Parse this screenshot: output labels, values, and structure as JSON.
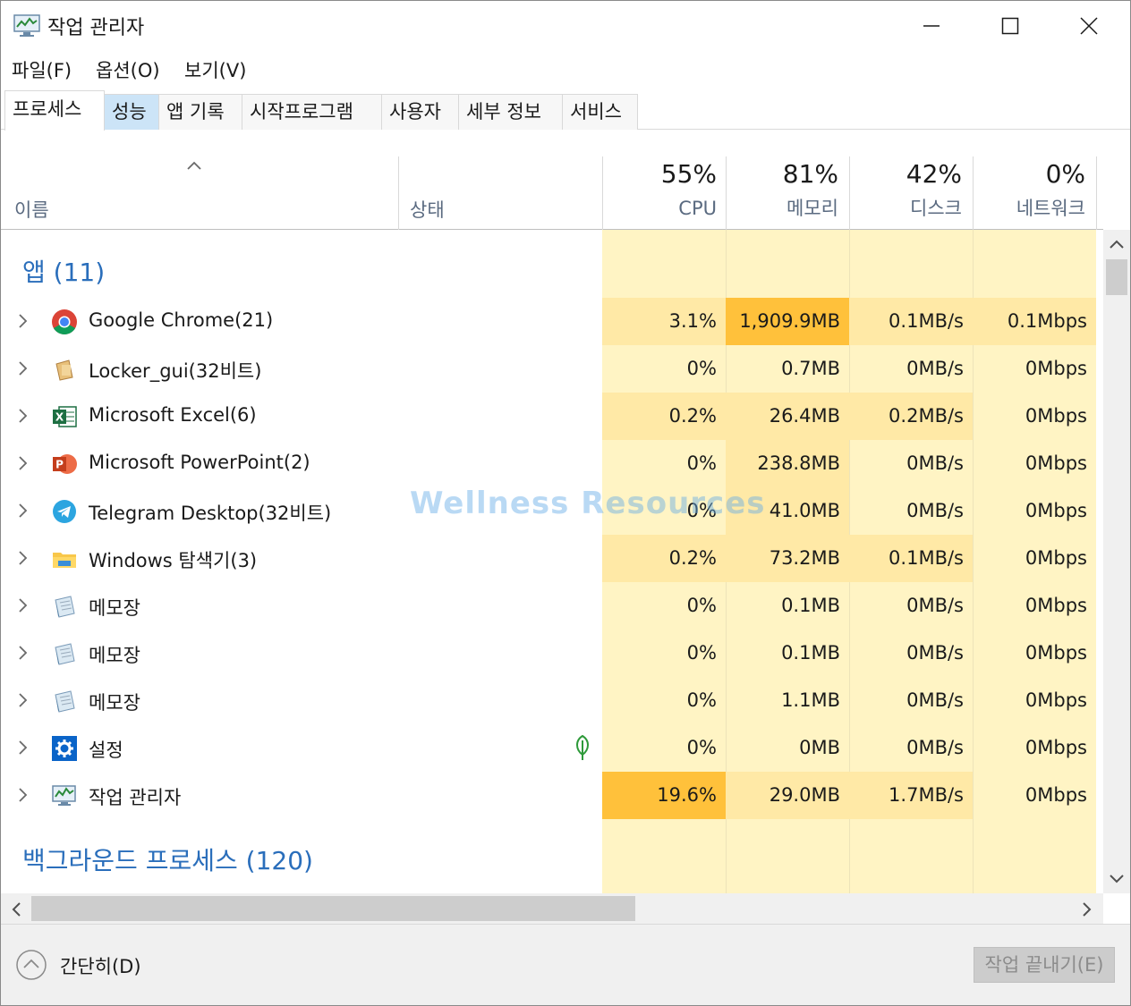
{
  "window": {
    "title": "작업 관리자"
  },
  "menu": [
    "파일(F)",
    "옵션(O)",
    "보기(V)"
  ],
  "tabs": [
    "프로세스",
    "성능",
    "앱 기록",
    "시작프로그램",
    "사용자",
    "세부 정보",
    "서비스"
  ],
  "columns": {
    "name": "이름",
    "status": "상태",
    "cpu": {
      "pct": "55%",
      "label": "CPU"
    },
    "memory": {
      "pct": "81%",
      "label": "메모리"
    },
    "disk": {
      "pct": "42%",
      "label": "디스크"
    },
    "network": {
      "pct": "0%",
      "label": "네트워크"
    }
  },
  "groups": {
    "apps": "앱 (11)",
    "background": "백그라운드 프로세스 (120)"
  },
  "rows": [
    {
      "name": "Google Chrome(21)",
      "icon": "chrome-icon",
      "cpu": "3.1%",
      "memory": "1,909.9MB",
      "disk": "0.1MB/s",
      "network": "0.1Mbps"
    },
    {
      "name": "Locker_gui(32비트)",
      "icon": "locker-icon",
      "cpu": "0%",
      "memory": "0.7MB",
      "disk": "0MB/s",
      "network": "0Mbps"
    },
    {
      "name": "Microsoft Excel(6)",
      "icon": "excel-icon",
      "cpu": "0.2%",
      "memory": "26.4MB",
      "disk": "0.2MB/s",
      "network": "0Mbps"
    },
    {
      "name": "Microsoft PowerPoint(2)",
      "icon": "powerpoint-icon",
      "cpu": "0%",
      "memory": "238.8MB",
      "disk": "0MB/s",
      "network": "0Mbps"
    },
    {
      "name": "Telegram Desktop(32비트)",
      "icon": "telegram-icon",
      "cpu": "0%",
      "memory": "41.0MB",
      "disk": "0MB/s",
      "network": "0Mbps"
    },
    {
      "name": "Windows 탐색기(3)",
      "icon": "explorer-icon",
      "cpu": "0.2%",
      "memory": "73.2MB",
      "disk": "0.1MB/s",
      "network": "0Mbps"
    },
    {
      "name": "메모장",
      "icon": "notepad-icon",
      "cpu": "0%",
      "memory": "0.1MB",
      "disk": "0MB/s",
      "network": "0Mbps"
    },
    {
      "name": "메모장",
      "icon": "notepad-icon",
      "cpu": "0%",
      "memory": "0.1MB",
      "disk": "0MB/s",
      "network": "0Mbps"
    },
    {
      "name": "메모장",
      "icon": "notepad-icon",
      "cpu": "0%",
      "memory": "1.1MB",
      "disk": "0MB/s",
      "network": "0Mbps"
    },
    {
      "name": "설정",
      "icon": "settings-gear-icon",
      "cpu": "0%",
      "memory": "0MB",
      "disk": "0MB/s",
      "network": "0Mbps",
      "status_icon": "efficiency-leaf-icon"
    },
    {
      "name": "작업 관리자",
      "icon": "task-manager-icon",
      "cpu": "19.6%",
      "memory": "29.0MB",
      "disk": "1.7MB/s",
      "network": "0Mbps"
    }
  ],
  "watermark": "Wellness Resources",
  "footer": {
    "fewer_details": "간단히(D)",
    "end_task": "작업 끝내기(E)"
  },
  "colors": {
    "heat_light": "#fff4c4",
    "heat_mid": "#ffe9a6",
    "heat_high": "#ffd35c",
    "heat_max": "#ffc13b",
    "accent_blue": "#2a6ebb"
  }
}
